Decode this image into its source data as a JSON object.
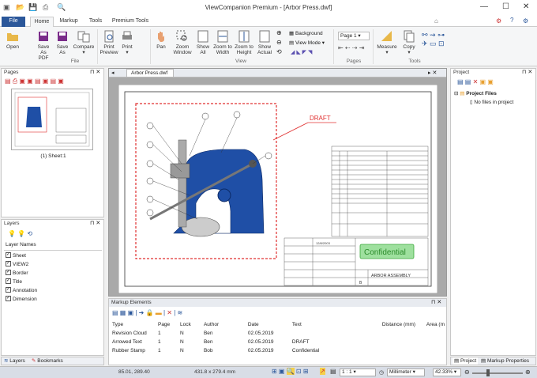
{
  "window": {
    "title": "ViewCompanion Premium - [Arbor Press.dwf]"
  },
  "tabs": [
    "File",
    "Home",
    "Markup",
    "Tools",
    "Premium Tools"
  ],
  "ribbon": {
    "buttons": {
      "open": "Open",
      "save_pdf_1": "Save",
      "save_pdf_2": "As PDF",
      "save_as_1": "Save",
      "save_as_2": "As",
      "compare": "Compare",
      "print_preview_1": "Print",
      "print_preview_2": "Preview",
      "print": "Print",
      "pan": "Pan",
      "zoom_window_1": "Zoom",
      "zoom_window_2": "Window",
      "show_all_1": "Show",
      "show_all_2": "All",
      "zoom_width_1": "Zoom to",
      "zoom_width_2": "Width",
      "zoom_height_1": "Zoom to",
      "zoom_height_2": "Height",
      "show_actual_1": "Show",
      "show_actual_2": "Actual",
      "background": "Background",
      "view_mode": "View Mode",
      "measure": "Measure",
      "copy": "Copy"
    },
    "page_select": "Page 1",
    "groups": {
      "file": "File",
      "view": "View",
      "pages": "Pages",
      "tools": "Tools"
    }
  },
  "pages_panel": {
    "title": "Pages",
    "thumb_label": "(1) Sheet:1"
  },
  "layers_panel": {
    "title": "Layers",
    "header": "Layer Names",
    "layers": [
      "Sheet",
      "VIEW2",
      "Border",
      "Title",
      "Annotation",
      "Dimension"
    ]
  },
  "left_tabs": {
    "layers": "Layers",
    "bookmarks": "Bookmarks"
  },
  "doc": {
    "tab": "Arbor Press.dwf",
    "draft": "DRAFT",
    "confidential": "Confidential",
    "drawing_title": "ARBOR ASSEMBLY",
    "size_letter": "B",
    "date": "12/8/2003"
  },
  "project_panel": {
    "title": "Project",
    "root": "Project Files",
    "empty": "No files in project"
  },
  "right_tabs": {
    "project": "Project",
    "markup_props": "Markup Properties"
  },
  "markup": {
    "title": "Markup Elements",
    "columns": [
      "Type",
      "Page",
      "Lock",
      "Author",
      "Date",
      "Text",
      "Distance (mm)",
      "Area (m"
    ],
    "rows": [
      [
        "Revision Cloud",
        "1",
        "N",
        "Ben",
        "02.05.2019",
        "",
        ""
      ],
      [
        "Arrowed Text",
        "1",
        "N",
        "Ben",
        "02.05.2019",
        "DRAFT",
        ""
      ],
      [
        "Rubber Stamp",
        "1",
        "N",
        "Bob",
        "02.05.2019",
        "Confidential",
        ""
      ]
    ]
  },
  "status": {
    "coords": "85.01, 289.40",
    "size": "431.8 x 279.4 mm",
    "scale": "1 : 1",
    "units": "Millimeter",
    "zoom": "42.33%"
  },
  "colors": {
    "accent": "#2b579a",
    "red": "#e03030",
    "press_blue": "#1f4fa6",
    "stamp_green": "#9ee09e"
  }
}
